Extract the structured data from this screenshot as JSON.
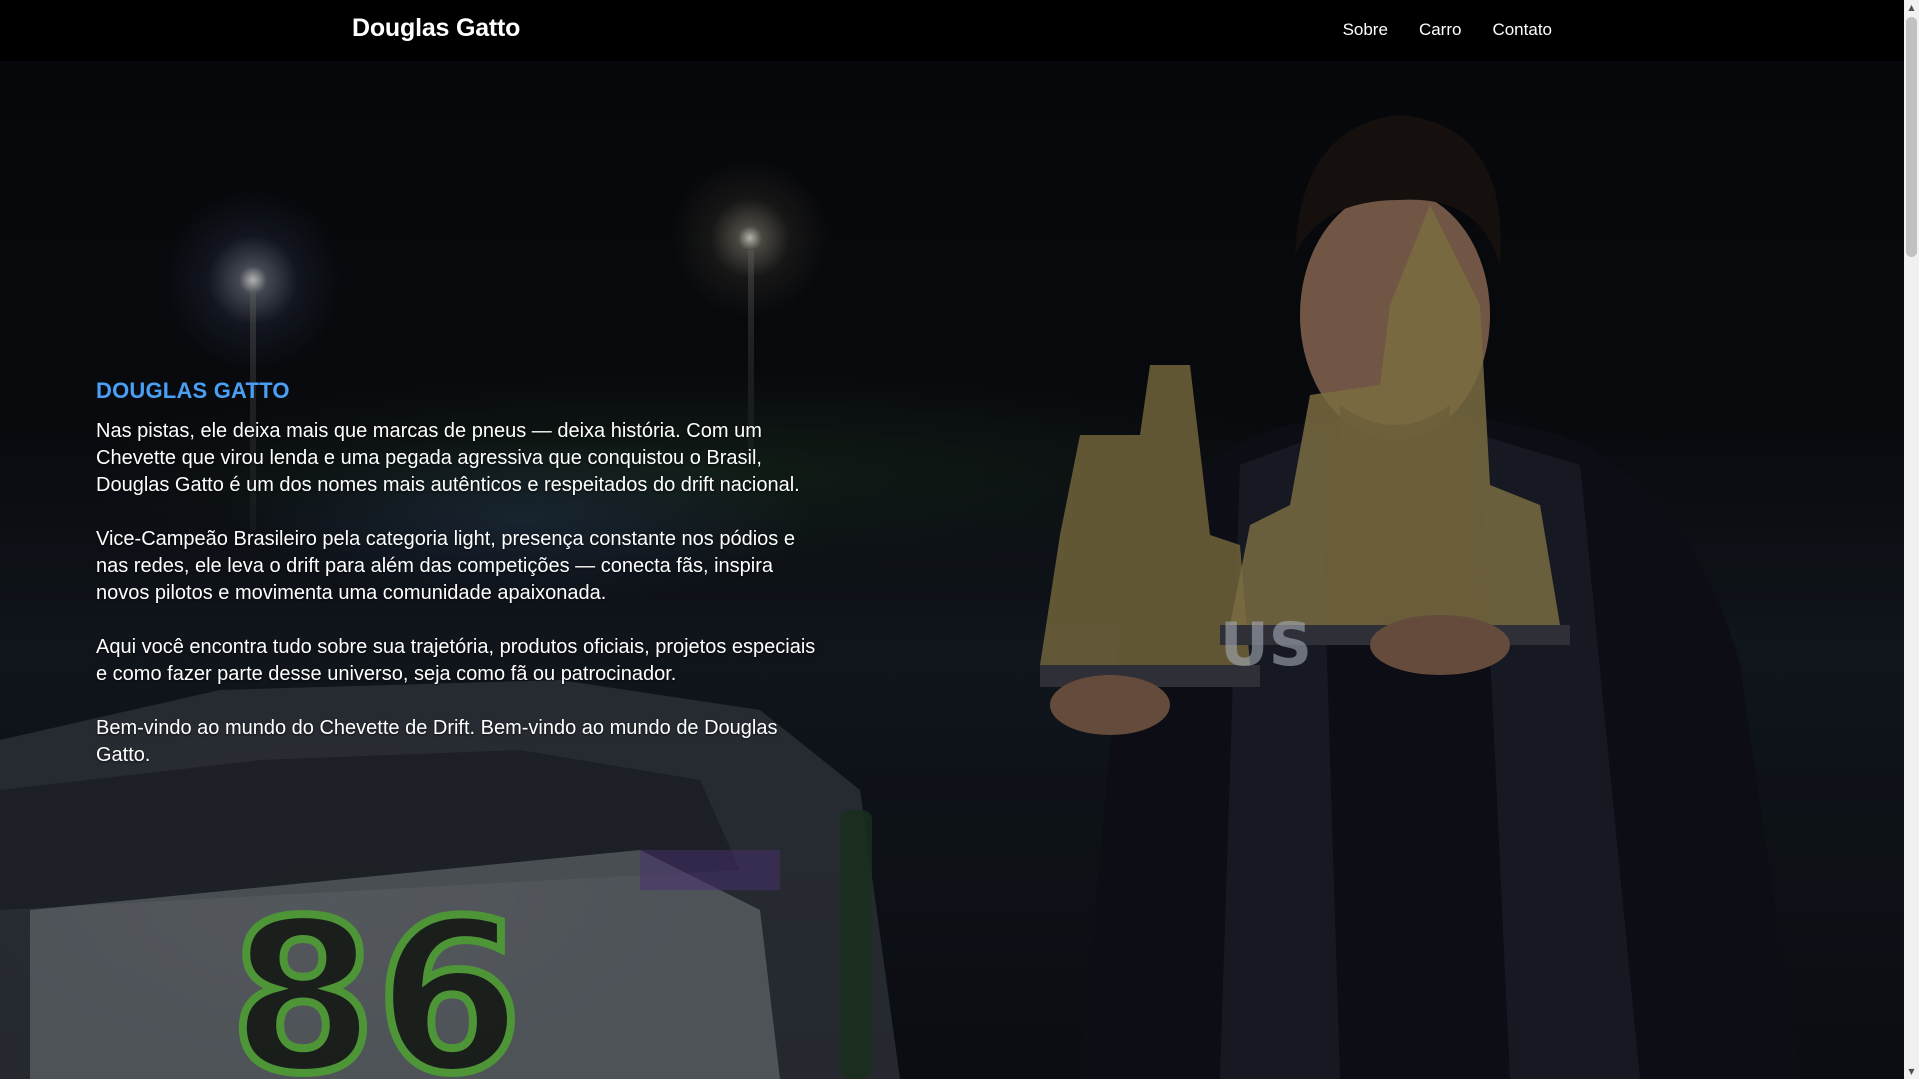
{
  "navbar": {
    "brand": "Douglas Gatto",
    "links": [
      {
        "label": "Sobre"
      },
      {
        "label": "Carro"
      },
      {
        "label": "Contato"
      }
    ]
  },
  "hero": {
    "title": "DOUGLAS GATTO",
    "paragraphs": [
      "Nas pistas, ele deixa mais que marcas de pneus — deixa história. Com um Chevette que virou lenda e uma pegada agressiva que conquistou o Brasil, Douglas Gatto é um dos nomes mais autênticos e respeitados do drift nacional.",
      "Vice-Campeão Brasileiro pela categoria light, presença constante nos pódios e nas redes, ele leva o drift para além das competições — conecta fãs, inspira novos pilotos e movimenta uma comunidade apaixonada.",
      "Aqui você encontra tudo sobre sua trajetória, produtos oficiais, projetos especiais e como fazer parte desse universo, seja como fã ou patrocinador.",
      "Bem-vindo ao mundo do Chevette de Drift. Bem-vindo ao mundo de Douglas Gatto."
    ]
  },
  "colors": {
    "accent": "#4a9ff5",
    "navbar_bg": "#000000",
    "text": "#ffffff"
  },
  "icons": {
    "scroll_up": "scroll-up-arrow-icon",
    "scroll_down": "scroll-down-arrow-icon"
  }
}
